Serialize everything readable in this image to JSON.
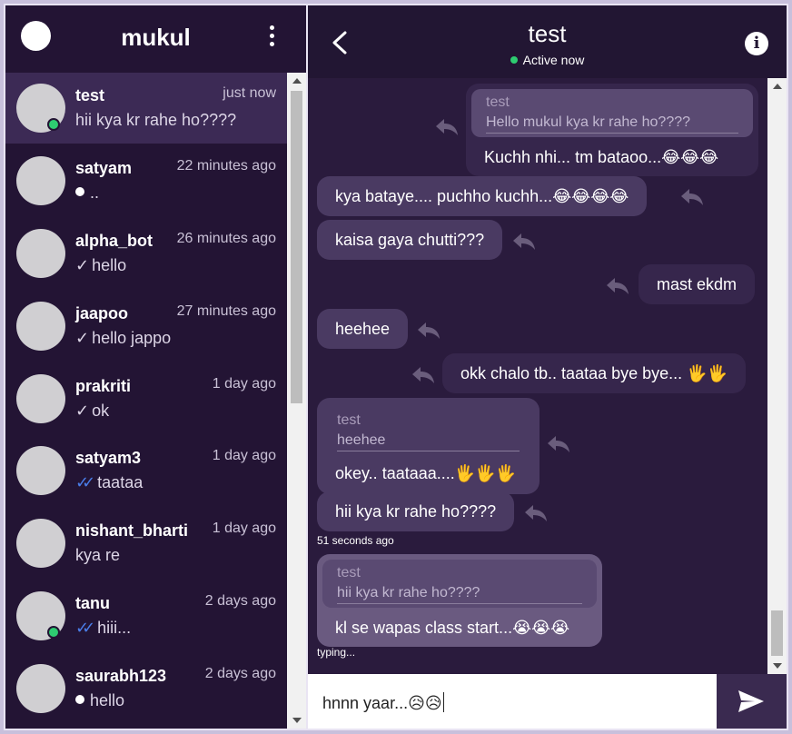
{
  "sidebar": {
    "username": "mukul",
    "chats": [
      {
        "name": "test",
        "time": "just now",
        "message": "hii kya kr rahe ho????",
        "status": "none",
        "online": true,
        "active": true
      },
      {
        "name": "satyam",
        "time": "22 minutes ago",
        "message": "..",
        "status": "dot",
        "online": false,
        "active": false
      },
      {
        "name": "alpha_bot",
        "time": "26 minutes ago",
        "message": "hello",
        "status": "tick",
        "online": false,
        "active": false
      },
      {
        "name": "jaapoo",
        "time": "27 minutes ago",
        "message": "hello jappo",
        "status": "tick",
        "online": false,
        "active": false
      },
      {
        "name": "prakriti",
        "time": "1 day ago",
        "message": "ok",
        "status": "tick",
        "online": false,
        "active": false
      },
      {
        "name": "satyam3",
        "time": "1 day ago",
        "message": "taataa",
        "status": "double-tick",
        "online": false,
        "active": false
      },
      {
        "name": "nishant_bharti",
        "time": "1 day ago",
        "message": "kya re",
        "status": "none",
        "online": false,
        "active": false
      },
      {
        "name": "tanu",
        "time": "2 days ago",
        "message": "hiii...",
        "status": "double-tick",
        "online": true,
        "active": false
      },
      {
        "name": "saurabh123",
        "time": "2 days ago",
        "message": "hello",
        "status": "dot",
        "online": false,
        "active": false
      }
    ]
  },
  "header": {
    "peer_name": "test",
    "presence": "Active now"
  },
  "messages": {
    "m1": {
      "reply_to_name": "test",
      "reply_to_text": "Hello mukul kya kr rahe ho????",
      "text": "Kuchh nhi... tm bataoo...😂😂😂"
    },
    "m2": {
      "text": "kya bataye.... puchho kuchh...😂😂😂😂"
    },
    "m3": {
      "text": "kaisa gaya chutti???"
    },
    "m4": {
      "text": "mast ekdm"
    },
    "m5": {
      "text": "heehee"
    },
    "m6": {
      "text": "okk chalo tb.. taataa bye bye... 🖐🖐"
    },
    "m7": {
      "reply_to_name": "test",
      "reply_to_text": "heehee",
      "text": "okey.. taataaa....🖐🖐🖐"
    },
    "m8": {
      "text": "hii kya kr rahe ho????",
      "time": "51 seconds ago"
    },
    "m9": {
      "reply_to_name": "test",
      "reply_to_text": "hii kya kr rahe ho????",
      "text": "kl se wapas class start...😭😭😭",
      "status": "typing..."
    }
  },
  "composer": {
    "value": "hnnn yaar...😥😥"
  },
  "colors": {
    "sidebar_bg": "#231434",
    "chat_bg": "#2a1b3d",
    "received_bubble": "#4a3a62",
    "sent_bubble": "#36264c",
    "online": "#2ecc71",
    "read_tick": "#4a7de8"
  },
  "icons": {
    "back": "chevron-left-icon",
    "info": "info-icon",
    "menu": "kebab-menu-icon",
    "reply": "reply-arrow-icon",
    "send": "send-icon"
  }
}
